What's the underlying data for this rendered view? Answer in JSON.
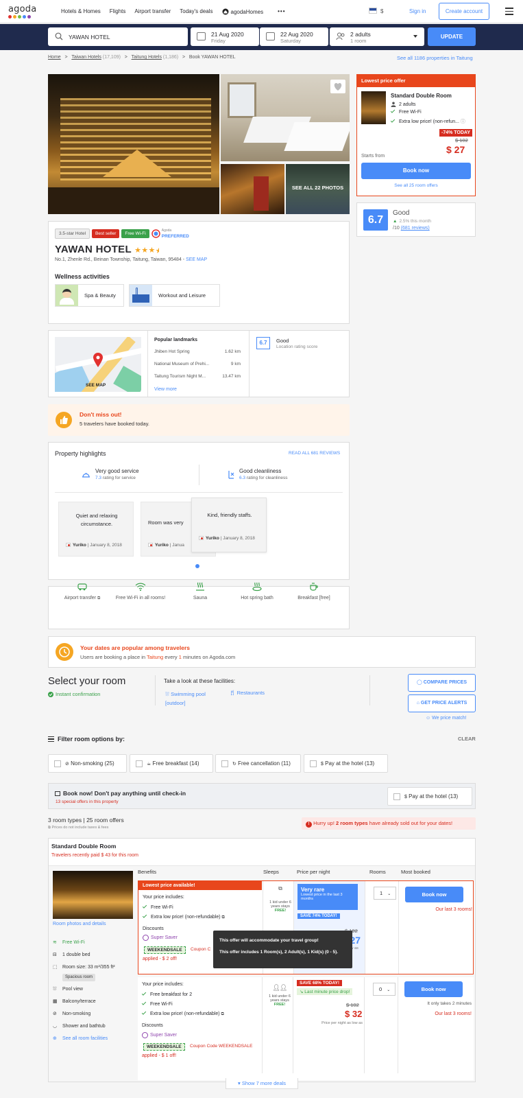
{
  "logo": {
    "text": "agoda",
    "dot_colors": [
      "#e2312f",
      "#f5a623",
      "#76bf43",
      "#488bf8",
      "#8e44ad"
    ]
  },
  "nav": {
    "items": [
      "Hotels & Homes",
      "Flights",
      "Airport transfer",
      "Today's deals",
      "agodaHomes"
    ],
    "currency": "$",
    "signin": "Sign in",
    "create": "Create account"
  },
  "search": {
    "hotel": "YAWAN HOTEL",
    "checkin_date": "21 Aug 2020",
    "checkin_day": "Friday",
    "checkout_date": "22 Aug 2020",
    "checkout_day": "Saturday",
    "guests": "2 adults",
    "rooms": "1 room",
    "update": "UPDATE"
  },
  "breadcrumb": {
    "home": "Home",
    "taiwan": "Taiwan Hotels",
    "taiwan_count": "(17,109)",
    "taitung": "Taitung Hotels",
    "taitung_count": "(1,186)",
    "current": "Book YAWAN HOTEL",
    "see_all": "See all 1186 properties in Taitung"
  },
  "gallery": {
    "see_all": "SEE ALL 22 PHOTOS"
  },
  "offer": {
    "header": "Lowest price offer",
    "room": "Standard Double Room",
    "adults": "2 adults",
    "wifi": "Free Wi-Fi",
    "low": "Extra low price! (non-refun...",
    "badge": "-74% TODAY",
    "old_price": "$ 102",
    "price": "$ 27",
    "starts": "Starts from",
    "book": "Book now",
    "see_all": "See all 25 room offers"
  },
  "review_score": {
    "score": "6.7",
    "label": "Good",
    "trend": "2.5% this month",
    "out_of": "/10",
    "reviews": "(681 reviews)"
  },
  "hotel": {
    "tags": [
      "3.5-star Hotel",
      "Best seller",
      "Free Wi-Fi"
    ],
    "preferred_small": "Agoda",
    "preferred": "PREFERRED",
    "name": "YAWAN HOTEL",
    "stars": "★★★",
    "half_star": "★",
    "address": "No.1, Zhenle Rd., Beinan Township, Taitung, Taiwan, 95484 - ",
    "see_map": "SEE MAP",
    "wellness_title": "Wellness activities",
    "wellness": [
      "Spa & Beauty",
      "Workout and Leisure"
    ]
  },
  "location": {
    "see_map": "SEE MAP",
    "landmarks_title": "Popular landmarks",
    "landmarks": [
      {
        "name": "Jhiben Hot Spring",
        "dist": "1.62 km"
      },
      {
        "name": "National Museum of Prehi...",
        "dist": "9 km"
      },
      {
        "name": "Taitung Tourism Night M...",
        "dist": "13.47 km"
      }
    ],
    "view_more": "View more",
    "score": "6.7",
    "score_label": "Good",
    "score_sub": "Location rating score"
  },
  "dont_miss": {
    "title": "Don't miss out!",
    "sub": "5 travelers have booked today."
  },
  "highlights": {
    "title": "Property highlights",
    "read_all": "READ ALL 681 REVIEWS",
    "service_title": "Very good service",
    "service_score": "7.3",
    "service_sub": "rating for service",
    "clean_title": "Good cleanliness",
    "clean_score": "6.3",
    "clean_sub": "rating for cleanliness",
    "reviews": [
      {
        "text": "Quiet and relaxing circumstance.",
        "author": "Yuriko",
        "date": "January 8, 2018"
      },
      {
        "text": "Room was very",
        "author": "Yuriko",
        "date": "Janua"
      },
      {
        "text": "Kind, friendly staffs.",
        "author": "Yuriko",
        "date": "January 8, 2018"
      }
    ]
  },
  "amenities": [
    "Airport transfer",
    "Free Wi-Fi in all rooms!",
    "Sauna",
    "Hot spring bath",
    "Breakfast [free]"
  ],
  "popular": {
    "title": "Your dates are popular among travelers",
    "sub_pre": "Users are booking a place in ",
    "sub_city": "Taitung",
    "sub_mid": " every ",
    "sub_num": "1",
    "sub_post": " minutes on Agoda.com"
  },
  "select_room": {
    "title": "Select your room",
    "instant": "Instant confirmation",
    "facilities_title": "Take a look at these facilities:",
    "facilities": [
      "Swimming pool",
      "[outdoor]",
      "Restaurants"
    ],
    "compare": "COMPARE PRICES",
    "alerts": "GET PRICE ALERTS",
    "match": "We price match!"
  },
  "filter": {
    "title": "Filter room options by:",
    "clear": "CLEAR",
    "options": [
      "Non-smoking (25)",
      "Free breakfast (14)",
      "Free cancellation (11)",
      "Pay at the hotel (13)"
    ]
  },
  "paylater": {
    "title": "Book now! Don't pay anything until check-in",
    "sub": "13 special offers in this property",
    "option": "Pay at the hotel (13)"
  },
  "room_types": {
    "summary": "3 room types | 25 room offers",
    "note": "Prices do not include taxes & fees",
    "hurry_pre": "Hurry up! ",
    "hurry_bold": "2 room types",
    "hurry_post": " have already sold out for your dates!"
  },
  "room": {
    "name": "Standard Double Room",
    "recent": "Travelers recently paid $ 43 for this room",
    "photos_link": "Room photos and details",
    "features": [
      "Free Wi-Fi",
      "1 double bed",
      "Room size: 33 m²/355 ft²",
      "Pool view",
      "Balcony/terrace",
      "Non-smoking",
      "Shower and bathtub",
      "See all room facilities"
    ],
    "spacious": "Spacious room",
    "headers": [
      "Benefits",
      "Sleeps",
      "Price per night",
      "Rooms",
      "Most booked"
    ],
    "offer1": {
      "banner": "Lowest price available!",
      "includes": "Your price includes:",
      "benefits": [
        "Free Wi-Fi",
        "Extra low price! (non-refundable)"
      ],
      "discounts": "Discounts",
      "saver": "Super Saver",
      "coupon": "WEEKENDSALE",
      "coupon_text": "Coupon C",
      "applied": "applied - $ 2 off!",
      "kid": "1 kid under 6 years stays",
      "free": "FREE!",
      "rare": "Very rare",
      "rare_sub": "Lowest price in the last 3 months",
      "save": "SAVE 74% TODAY!",
      "old": "$ 102",
      "price": "27",
      "price_sub": "s low as",
      "qty": "1",
      "book": "Book now",
      "last": "Our last 3 rooms!"
    },
    "offer2": {
      "includes": "Your price includes:",
      "benefits": [
        "Free breakfast for 2",
        "Free Wi-Fi",
        "Extra low price! (non-refundable)"
      ],
      "discounts": "Discounts",
      "saver": "Super Saver",
      "coupon": "WEEKENDSALE",
      "coupon_text": "Coupon Code WEEKENDSALE",
      "applied": "applied - $ 1 off!",
      "kid": "1 kid under 6 years stays",
      "free": "FREE!",
      "save": "SAVE 68% TODAY!",
      "drop": "Last minute price drop!",
      "old": "$ 102",
      "price": "$ 32",
      "price_sub": "Price per night as low as",
      "qty": "0",
      "book": "Book now",
      "takes": "It only takes 2 minutes",
      "last": "Our last 3 rooms!"
    },
    "tooltip_line1": "This offer will accommodate your travel group!",
    "tooltip_line2": "This offer includes 1 Room(s), 2 Adult(s), 1 Kid(s) (0 - 5)."
  },
  "show_more": "Show 7 more deals"
}
